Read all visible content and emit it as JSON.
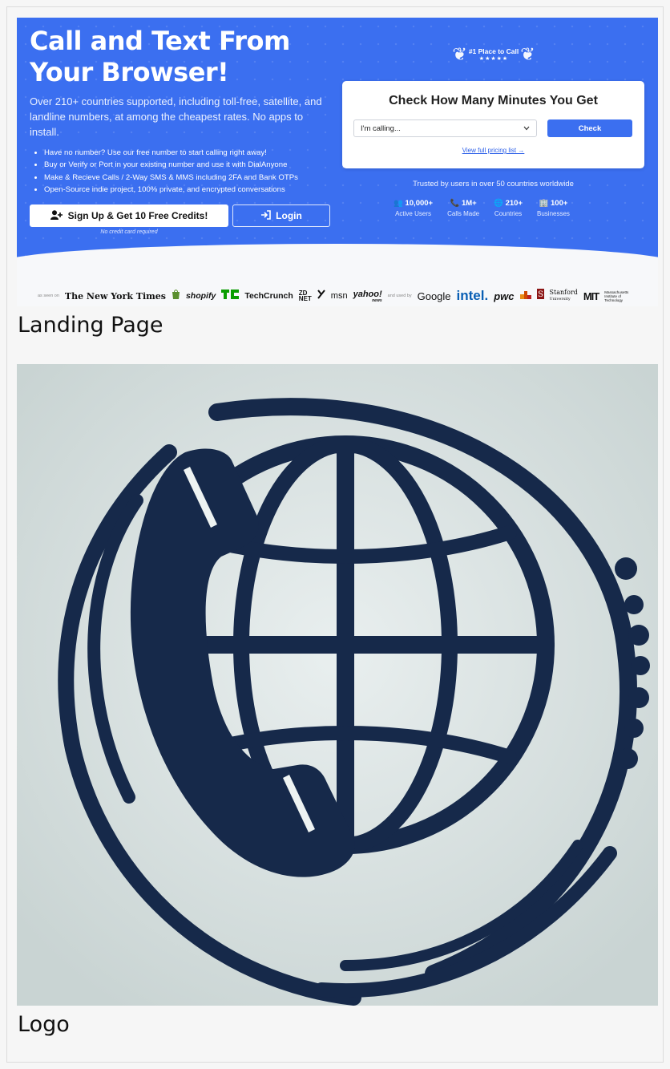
{
  "hero": {
    "title": "Call and Text From Your Browser!",
    "subtitle": "Over 210+ countries supported, including toll-free, satellite, and landline numbers, at among the cheapest rates. No apps to install.",
    "bullets": [
      "Have no number? Use our free number to start calling right away!",
      "Buy or Verify or Port in your existing number and use it with DialAnyone",
      "Make & Recieve Calls / 2-Way SMS & MMS including 2FA and Bank OTPs",
      "Open-Source indie project, 100% private, and encrypted conversations"
    ],
    "signup_label": "Sign Up & Get 10 Free Credits!",
    "login_label": "Login",
    "no_card_note": "No credit card required"
  },
  "badge": {
    "title": "#1 Place to Call",
    "stars": "★★★★★"
  },
  "minutes_card": {
    "title": "Check How Many Minutes You Get",
    "select_value": "I'm calling...",
    "check_label": "Check",
    "pricing_link": "View full pricing list →"
  },
  "trust": {
    "text": "Trusted by users in over 50 countries worldwide",
    "stats": [
      {
        "icon": "users-icon",
        "glyph": "👥",
        "value": "10,000+",
        "label": "Active Users"
      },
      {
        "icon": "phone-icon",
        "glyph": "📞",
        "value": "1M+",
        "label": "Calls Made"
      },
      {
        "icon": "globe-icon",
        "glyph": "🌐",
        "value": "210+",
        "label": "Countries"
      },
      {
        "icon": "building-icon",
        "glyph": "🏢",
        "value": "100+",
        "label": "Businesses"
      }
    ]
  },
  "press": {
    "seen_on": "as seen on",
    "used_by": "and used by",
    "nyt": "The New York Times",
    "shopify": "shopify",
    "techcrunch": "TechCrunch",
    "zdnet_top": "ZD",
    "zdnet_bottom": "NET",
    "msn": "msn",
    "yahoo": "yahoo!",
    "yahoo_sub": "news",
    "google": "Google",
    "intel": "intel.",
    "pwc": "pwc",
    "stanford": "Stanford",
    "stanford_sub": "University",
    "mit": "MIT",
    "mit_sub": "Massachusetts Institute of Technology"
  },
  "captions": {
    "landing": "Landing Page",
    "logo": "Logo"
  },
  "colors": {
    "brand_blue": "#3b6ff0",
    "logo_navy": "#15294a",
    "logo_bg": "#cfd9d9"
  }
}
